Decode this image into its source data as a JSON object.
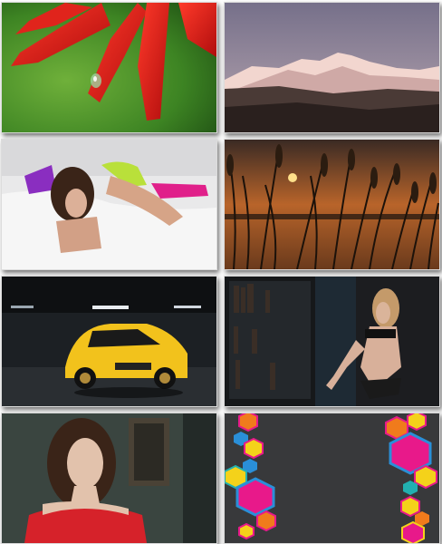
{
  "gallery": {
    "tiles": [
      {
        "subject": "red-flower-with-water-drop",
        "colors": {
          "bg": "#3f8a23",
          "main": "#d41414"
        }
      },
      {
        "subject": "snowy-mountains-at-dusk",
        "colors": {
          "sky": "#8a7c92",
          "snow": "#f0d8d2"
        }
      },
      {
        "subject": "woman-lying-on-bed",
        "colors": {
          "bed": "#f4f4f4",
          "accent": "#b9e03a"
        }
      },
      {
        "subject": "sunset-with-grass",
        "colors": {
          "sky": "#c0702a",
          "grass": "#2b1c10"
        }
      },
      {
        "subject": "yellow-car-in-garage",
        "colors": {
          "car": "#f2c21c",
          "bg": "#1e2226"
        }
      },
      {
        "subject": "woman-by-bookshelf",
        "colors": {
          "bg": "#1a1c1f",
          "skin": "#d9b29a"
        }
      },
      {
        "subject": "woman-in-red-top",
        "colors": {
          "bg": "#3b4640",
          "top": "#d6222a"
        }
      },
      {
        "subject": "colorful-hexagons",
        "colors": {
          "bg": "#3b3b3d",
          "magenta": "#e8198a",
          "blue": "#2a8fd8",
          "yellow": "#f4d21a",
          "orange": "#f07b1c"
        }
      }
    ]
  }
}
